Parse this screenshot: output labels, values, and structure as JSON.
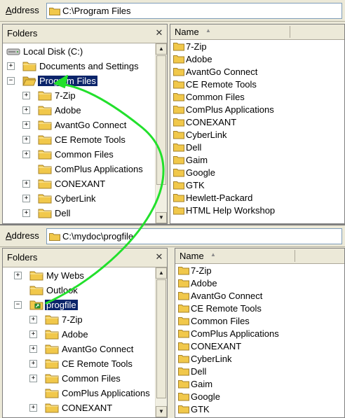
{
  "top": {
    "address_label": "Address",
    "address_value": "C:\\Program Files",
    "folders_title": "Folders",
    "name_header": "Name",
    "tree": [
      {
        "label": "Local Disk (C:)",
        "icon": "drive-icon",
        "expander": "none",
        "selected": false
      },
      {
        "label": "Documents and Settings",
        "icon": "folder-icon",
        "expander": "plus",
        "selected": false
      },
      {
        "label": "Program Files",
        "icon": "folder-open-icon",
        "expander": "minus",
        "selected": true
      },
      {
        "label": "7-Zip",
        "icon": "folder-icon",
        "expander": "plus",
        "selected": false
      },
      {
        "label": "Adobe",
        "icon": "folder-icon",
        "expander": "plus",
        "selected": false
      },
      {
        "label": "AvantGo Connect",
        "icon": "folder-icon",
        "expander": "plus",
        "selected": false
      },
      {
        "label": "CE Remote Tools",
        "icon": "folder-icon",
        "expander": "plus",
        "selected": false
      },
      {
        "label": "Common Files",
        "icon": "folder-icon",
        "expander": "plus",
        "selected": false
      },
      {
        "label": "ComPlus Applications",
        "icon": "folder-icon",
        "expander": "none",
        "selected": false
      },
      {
        "label": "CONEXANT",
        "icon": "folder-icon",
        "expander": "plus",
        "selected": false
      },
      {
        "label": "CyberLink",
        "icon": "folder-icon",
        "expander": "plus",
        "selected": false
      },
      {
        "label": "Dell",
        "icon": "folder-icon",
        "expander": "plus",
        "selected": false
      }
    ],
    "files": [
      "7-Zip",
      "Adobe",
      "AvantGo Connect",
      "CE Remote Tools",
      "Common Files",
      "ComPlus Applications",
      "CONEXANT",
      "CyberLink",
      "Dell",
      "Gaim",
      "Google",
      "GTK",
      "Hewlett-Packard",
      "HTML Help Workshop"
    ]
  },
  "bottom": {
    "address_label": "Address",
    "address_value": "C:\\mydoc\\progfile",
    "folders_title": "Folders",
    "name_header": "Name",
    "tree": [
      {
        "label": "My Webs",
        "icon": "folder-icon",
        "expander": "plus",
        "selected": false
      },
      {
        "label": "Outlook",
        "icon": "folder-icon",
        "expander": "none",
        "selected": false
      },
      {
        "label": "progfile",
        "icon": "junction-folder-icon",
        "expander": "minus",
        "selected": true
      },
      {
        "label": "7-Zip",
        "icon": "folder-icon",
        "expander": "plus",
        "selected": false
      },
      {
        "label": "Adobe",
        "icon": "folder-icon",
        "expander": "plus",
        "selected": false
      },
      {
        "label": "AvantGo Connect",
        "icon": "folder-icon",
        "expander": "plus",
        "selected": false
      },
      {
        "label": "CE Remote Tools",
        "icon": "folder-icon",
        "expander": "plus",
        "selected": false
      },
      {
        "label": "Common Files",
        "icon": "folder-icon",
        "expander": "plus",
        "selected": false
      },
      {
        "label": "ComPlus Applications",
        "icon": "folder-icon",
        "expander": "none",
        "selected": false
      },
      {
        "label": "CONEXANT",
        "icon": "folder-icon",
        "expander": "plus",
        "selected": false
      }
    ],
    "files": [
      "7-Zip",
      "Adobe",
      "AvantGo Connect",
      "CE Remote Tools",
      "Common Files",
      "ComPlus Applications",
      "CONEXANT",
      "CyberLink",
      "Dell",
      "Gaim",
      "Google",
      "GTK"
    ]
  },
  "colors": {
    "selection": "#0a246a",
    "folder": "#f1c84b",
    "arrow": "#22e02c"
  }
}
